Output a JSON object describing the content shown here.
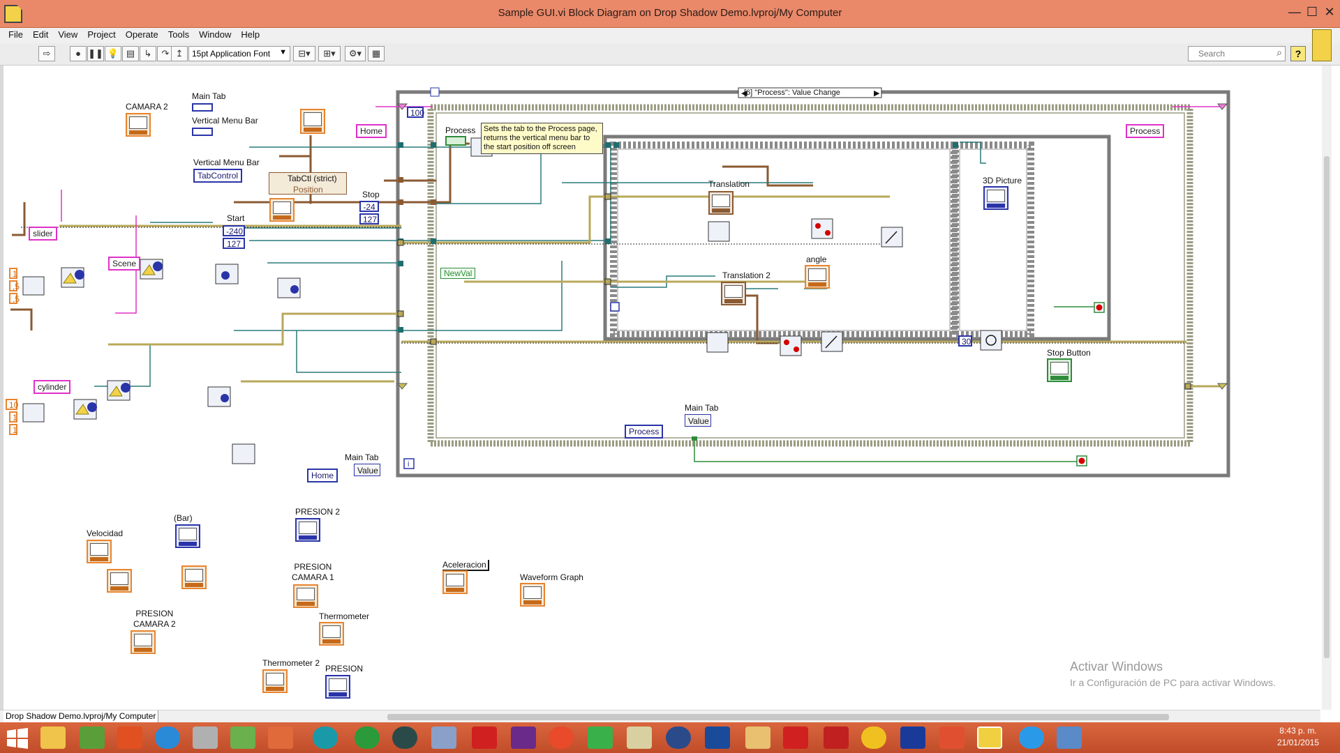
{
  "window": {
    "title": "Sample GUI.vi Block Diagram on Drop Shadow Demo.lvproj/My Computer",
    "minimize": "—",
    "maximize": "☐",
    "close": "✕"
  },
  "menu": [
    "File",
    "Edit",
    "View",
    "Project",
    "Operate",
    "Tools",
    "Window",
    "Help"
  ],
  "toolbar": {
    "font": "15pt Application Font",
    "search_placeholder": "Search",
    "help": "?"
  },
  "diagram": {
    "labels": {
      "camara2": "CAMARA 2",
      "main_tab": "Main Tab",
      "vertical_menu_bar": "Vertical Menu Bar",
      "vertical_menu_bar2": "Vertical Menu Bar",
      "tabcontrol": "TabControl",
      "tabctl_strict": "TabCtl (strict)",
      "position": "Position",
      "start": "Start",
      "stop": "Stop",
      "process": "Process",
      "translation": "Translation",
      "translation2": "Translation 2",
      "angle": "angle",
      "picture3d": "3D Picture",
      "stop_button": "Stop Button",
      "main_tab2": "Main Tab",
      "main_tab3": "Main Tab",
      "value": "Value",
      "value2": "Value",
      "newval": "NewVal",
      "case_selector": "[6] \"Process\": Value Change",
      "velocidad": "Velocidad",
      "bar": "(Bar)",
      "presion2": "PRESION 2",
      "presion_camara1": "PRESION\nCAMARA 1",
      "presion_camara2": "PRESION\nCAMARA 2",
      "thermometer": "Thermometer",
      "thermometer2": "Thermometer 2",
      "presion": "PRESION",
      "aceleracion": "Aceleracion",
      "waveform_graph": "Waveform Graph"
    },
    "constants": {
      "home": "Home",
      "home_enum": "Home",
      "slider": "slider",
      "scene": "Scene",
      "cylinder": "cylinder",
      "process_str": "Process",
      "process_enum": "Process",
      "loop_count": "100",
      "wait_ms": "30",
      "start_a": "-240",
      "start_b": "127",
      "stop_a": "-24",
      "stop_b": "127",
      "left_a": "1",
      "left_b": ",5",
      "left_c": ",5",
      "left_d": "10",
      "left_e": "1",
      "left_f": "1"
    },
    "comment": "Sets the tab to the Process page, returns the vertical menu bar to the start position off screen",
    "watermark_title": "Activar Windows",
    "watermark_sub": "Ir a Configuración de PC para activar Windows."
  },
  "status": {
    "path": "Drop Shadow Demo.lvproj/My Computer"
  },
  "clock": {
    "time": "8:43 p. m.",
    "date": "21/01/2015"
  },
  "colors": {
    "titlebar": "#e9896a",
    "taskbar": "#c9522d",
    "wire_cluster": "#8a5a32",
    "wire_ref": "#2a7a7a",
    "wire_bool": "#2e8b3a",
    "wire_string": "#e030c8",
    "wire_error": "#b8a85a"
  }
}
